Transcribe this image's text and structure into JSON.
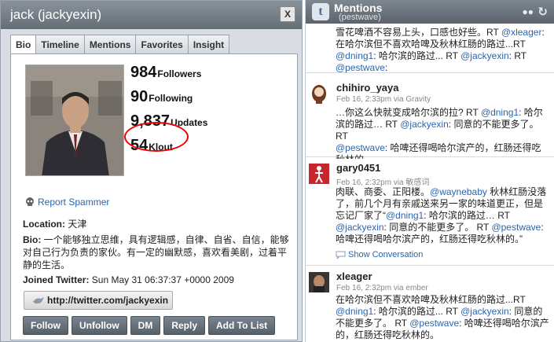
{
  "profile": {
    "title": "jack (jackyexin)",
    "close_label": "X",
    "tabs": [
      "Bio",
      "Timeline",
      "Mentions",
      "Favorites",
      "Insight"
    ],
    "stats": {
      "followers": "984",
      "followers_label": "Followers",
      "following": "90",
      "following_label": "Following",
      "updates": "9,837",
      "updates_label": "Updates",
      "klout": "54",
      "klout_label": "Klout"
    },
    "report_label": "Report Spammer",
    "location_label": "Location:",
    "location_value": " 天津",
    "bio_label": "Bio:",
    "bio_value": " 一个能够独立思维，具有逻辑感，自律、自省、自信，能够对自己行为负责的家伙。有一定的幽默感，喜欢看美剧，过着平静的生活。",
    "joined_label": "Joined Twitter:",
    "joined_value": " Sun May 31 06:37:37 +0000 2009",
    "url": "http://twitter.com/jackyexin",
    "actions": [
      "Follow",
      "Unfollow",
      "DM",
      "Reply",
      "Add To List"
    ]
  },
  "mentions": {
    "title": "Mentions",
    "subtitle": "(pestwave)",
    "tweets": [
      {
        "name": "",
        "meta": "",
        "l1a": "雪花啤酒不容易上头，口感也好些。RT ",
        "l1b": "@xleager",
        "l1c": ":",
        "l2a": "在哈尔滨但不喜欢哈啤及秋林红肠的路过...RT",
        "l3a": "@dning1",
        "l3b": ": 哈尔滨的路过... RT ",
        "l3c": "@jackyexin",
        "l3d": ": RT",
        "l4a": "@pestwave",
        "l4b": ":"
      },
      {
        "name": "chihiro_yaya",
        "meta": "Feb 16, 2:33pm via Gravity",
        "l1": "…你这么快就变成哈尔滨的拉? RT ",
        "l1l": "@dning1",
        "l1e": ": 哈尔",
        "l2": "滨的路过… RT ",
        "l2l": "@jackyexin",
        "l2e": ": 同意的不能更多了。 RT",
        "l3l": "@pestwave",
        "l3e": ": 哈啤还得喝哈尔滨产的，红肠还得吃",
        "l4": "秋林的。"
      },
      {
        "name": "gary0451",
        "meta": "Feb 16, 2:32pm via 敏感词",
        "l1": "肉联、商委、正阳楼。",
        "l1l": "@waynebaby",
        "l1e": " 秋林红肠没落",
        "l2": "了，前几个月有亲戚送来另一家的味道更正，但是",
        "l3": "忘记厂家了“",
        "l3l": "@dning1",
        "l3e": ": 哈尔滨的路过… RT",
        "l4l": "@jackyexin",
        "l4e": ": 同意的不能更多了。 RT ",
        "l4l2": "@pestwave",
        "l4e2": ":",
        "l5": "哈啤还得喝哈尔滨产的，红肠还得吃秋林的。”",
        "conv": "Show Conversation"
      },
      {
        "name": "xleager",
        "meta": "Feb 16, 2:32pm via ember",
        "l1": "在哈尔滨但不喜欢哈啤及秋林红肠的路过...RT",
        "l2l": "@dning1",
        "l2e": ": 哈尔滨的路过... RT ",
        "l2l2": "@jackyexin",
        "l2e2": ": 同意的",
        "l3": "不能更多了。 RT ",
        "l3l": "@pestwave",
        "l3e": ": 哈啤还得喝哈尔滨产",
        "l4": "的，红肠还得吃秋林的。"
      }
    ]
  }
}
